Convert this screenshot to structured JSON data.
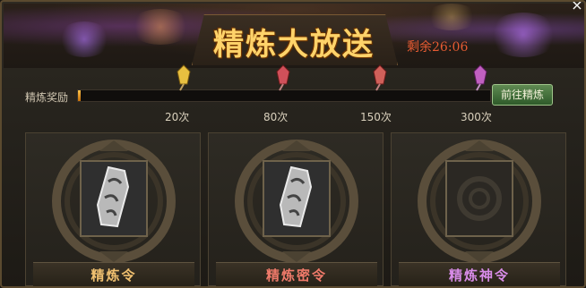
{
  "title": "精炼大放送",
  "timer": "剩余26:06",
  "close_icon": "×",
  "progress": {
    "label": "精炼奖励",
    "value": 0,
    "max": 300,
    "milestones": [
      {
        "label": "20次",
        "icon": "reward-crystal-icon",
        "color": "#e8c040"
      },
      {
        "label": "80次",
        "icon": "reward-crystal-icon",
        "color": "#d0505a"
      },
      {
        "label": "150次",
        "icon": "reward-crystal-icon",
        "color": "#d0605a"
      },
      {
        "label": "300次",
        "icon": "reward-crystal-icon",
        "color": "#c060c0"
      }
    ]
  },
  "goto_button": "前往精炼",
  "items": [
    {
      "name": "精炼令",
      "color": "#f0c070",
      "image": "token-icon"
    },
    {
      "name": "精炼密令",
      "color": "#ef7a6a",
      "image": "token-icon"
    },
    {
      "name": "精炼神令",
      "color": "#d88ce8",
      "image": "empty-token-icon"
    }
  ]
}
